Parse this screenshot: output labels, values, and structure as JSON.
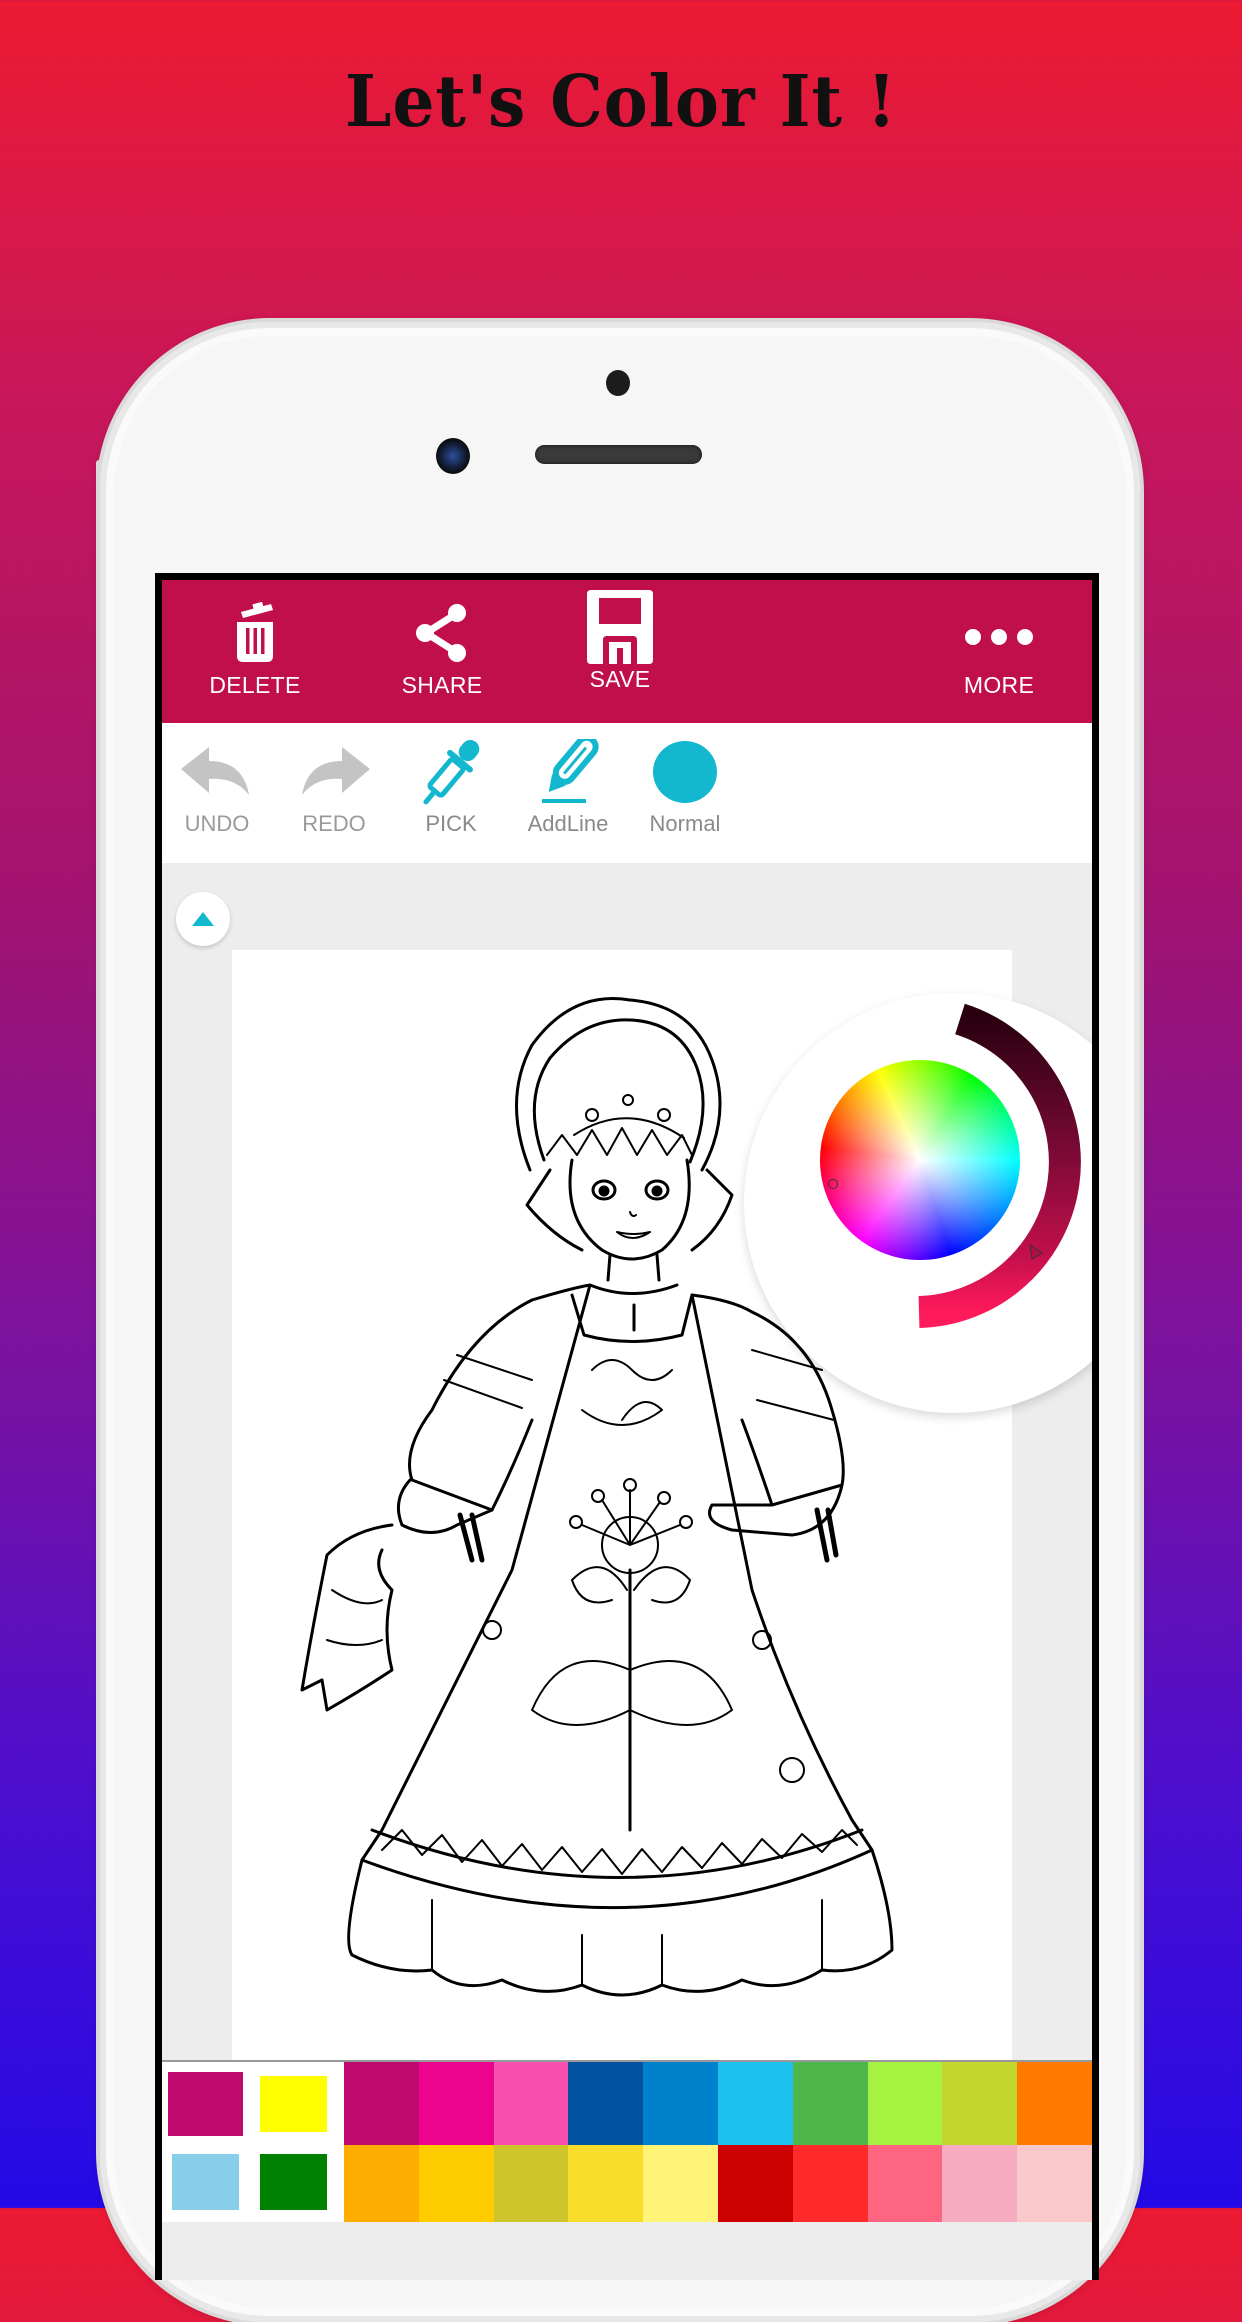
{
  "headline": "Let's Color It !",
  "toolbar": {
    "background": "#c10f4b",
    "buttons": [
      {
        "label": "DELETE",
        "icon": "trash-icon"
      },
      {
        "label": "SHARE",
        "icon": "share-icon"
      },
      {
        "label": "SAVE",
        "icon": "floppy-disk-icon"
      },
      {
        "label": "MORE",
        "icon": "more-dots-icon"
      }
    ]
  },
  "tools": [
    {
      "label": "UNDO",
      "icon": "undo-icon",
      "enabled": false
    },
    {
      "label": "REDO",
      "icon": "redo-icon",
      "enabled": false
    },
    {
      "label": "PICK",
      "icon": "eyedropper-icon",
      "enabled": true
    },
    {
      "label": "AddLine",
      "icon": "pencil-icon",
      "enabled": true
    },
    {
      "label": "Normal",
      "icon": "brush-dot-icon",
      "enabled": true
    }
  ],
  "accent_color": "#13b8cf",
  "color_picker": {
    "selected_hue": "#e8185a",
    "brightness_arc": [
      "#2a0010",
      "#7a0a35",
      "#c10f4b",
      "#ff1a5c"
    ]
  },
  "palette": {
    "recent": [
      "#bd0a6c",
      "#ffff00",
      "#87ceeb",
      "#008000"
    ],
    "row1": [
      "#bd0a6c",
      "#ec038e",
      "#f94faf",
      "#01529f",
      "#0081cb",
      "#1cc1f0",
      "#4db74a",
      "#a5f241",
      "#c3d62f",
      "#ff7b00"
    ],
    "row2": [
      "#ffac00",
      "#ffcc00",
      "#cec42c",
      "#f8dd2c",
      "#fff478",
      "#cc0000",
      "#ff2b2b",
      "#fd6581",
      "#f8acc1",
      "#f9c8c8"
    ]
  }
}
